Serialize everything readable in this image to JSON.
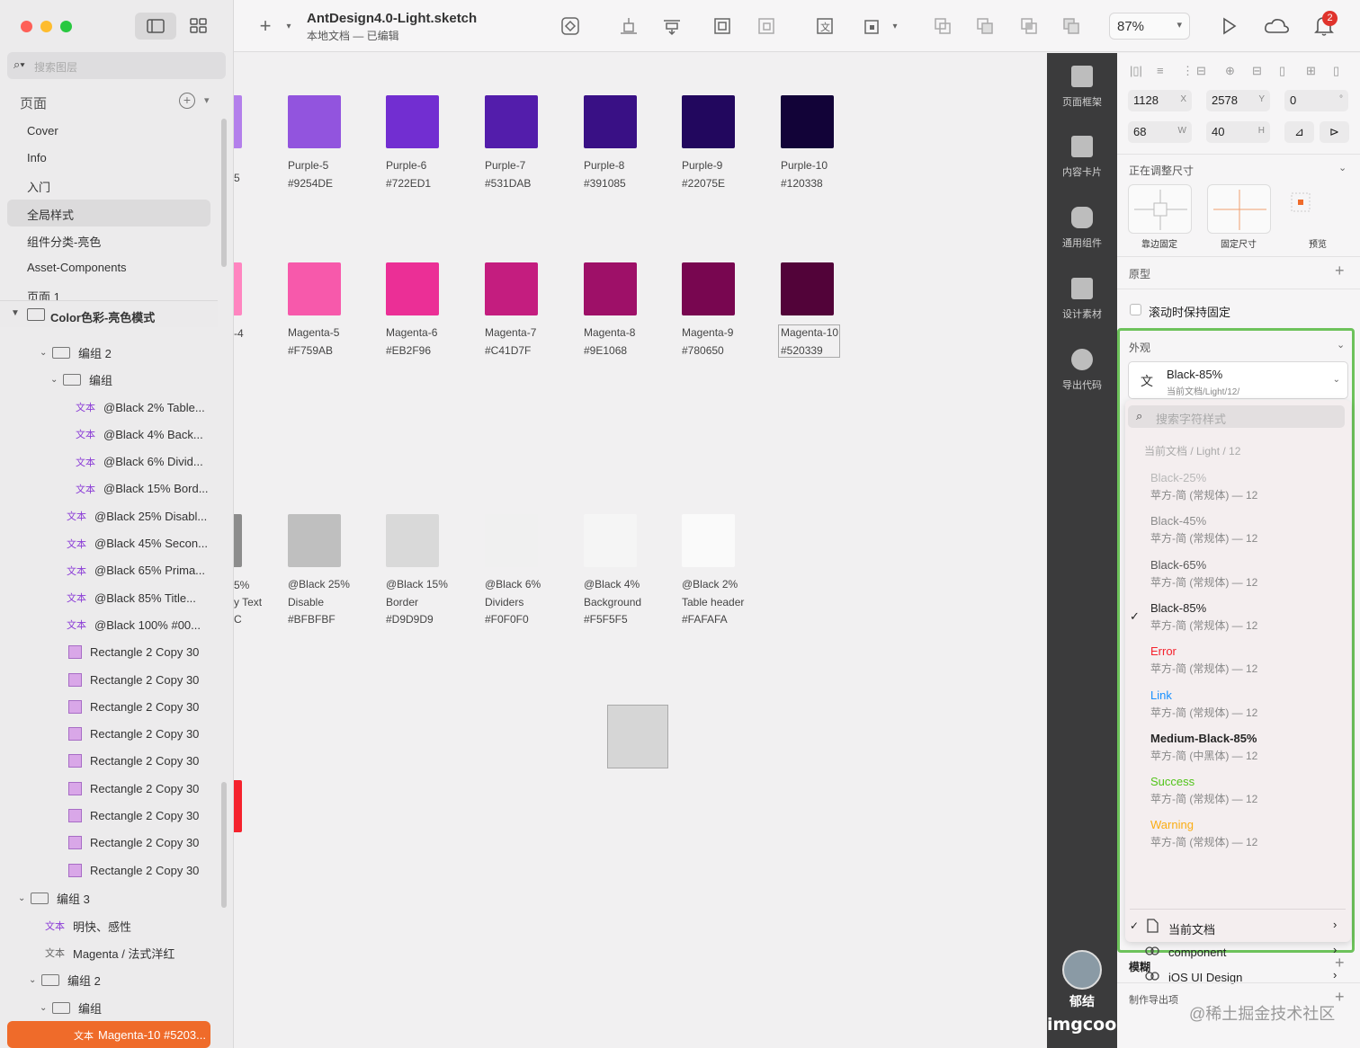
{
  "toolbar": {
    "title": "AntDesign4.0-Light.sketch",
    "subtitle": "本地文档 — 已编辑",
    "zoom": "87%",
    "notification_count": "2"
  },
  "sidebar": {
    "search_placeholder": "搜索图层",
    "pages_header": "页面",
    "pages": [
      "Cover",
      "Info",
      "入门",
      "全局样式",
      "组件分类-亮色",
      "Asset-Components",
      "页面 1"
    ],
    "selected_page_index": 3,
    "layers": {
      "top_artboard": "Color色彩-亮色模式",
      "group2_a": "编组 2",
      "group_a": "编组",
      "text_items": [
        "@Black 2% Table...",
        "@Black 4% Back...",
        "@Black 6% Divid...",
        "@Black 15% Bord..."
      ],
      "text_items2": [
        "@Black 25% Disabl...",
        "@Black 45% Secon...",
        "@Black 65% Prima...",
        "@Black 85% Title...",
        "@Black 100% #00..."
      ],
      "rect_label": "Rectangle 2 Copy 30",
      "rect_count": 9,
      "group3": "编组 3",
      "text_bright": "明快、感性",
      "text_magenta": "Magenta / 法式洋红",
      "group2_b": "编组 2",
      "group_b": "编组",
      "selected_layer": "Magenta-10 #5203...",
      "text_badge": "文本"
    }
  },
  "canvas": {
    "purple": [
      {
        "name": "Purple-5",
        "hex": "#9254DE",
        "color": "#9254DE"
      },
      {
        "name": "Purple-6",
        "hex": "#722ED1",
        "color": "#722ED1"
      },
      {
        "name": "Purple-7",
        "hex": "#531DAB",
        "color": "#531DAB"
      },
      {
        "name": "Purple-8",
        "hex": "#391085",
        "color": "#391085"
      },
      {
        "name": "Purple-9",
        "hex": "#22075E",
        "color": "#22075E"
      },
      {
        "name": "Purple-10",
        "hex": "#120338",
        "color": "#120338"
      }
    ],
    "magenta": [
      {
        "name": "Magenta-5",
        "hex": "#F759AB",
        "color": "#F759AB"
      },
      {
        "name": "Magenta-6",
        "hex": "#EB2F96",
        "color": "#EB2F96"
      },
      {
        "name": "Magenta-7",
        "hex": "#C41D7F",
        "color": "#C41D7F"
      },
      {
        "name": "Magenta-8",
        "hex": "#9E1068",
        "color": "#9E1068"
      },
      {
        "name": "Magenta-9",
        "hex": "#780650",
        "color": "#780650"
      },
      {
        "name": "Magenta-10",
        "hex": "#520339",
        "color": "#520339"
      }
    ],
    "black": [
      {
        "name": "@Black 25%",
        "sub": "Disable",
        "hex": "#BFBFBF",
        "color": "#BFBFBF"
      },
      {
        "name": "@Black 15%",
        "sub": "Border",
        "hex": "#D9D9D9",
        "color": "#D9D9D9"
      },
      {
        "name": "@Black 6%",
        "sub": "Dividers",
        "hex": "#F0F0F0",
        "color": "#F0F0F0"
      },
      {
        "name": "@Black 4%",
        "sub": "Background",
        "hex": "#F5F5F5",
        "color": "#F5F5F5"
      },
      {
        "name": "@Black 2%",
        "sub": "Table header",
        "hex": "#FAFAFA",
        "color": "#FAFAFA"
      }
    ],
    "edge_texts": [
      "-4",
      "5%",
      "y Text",
      "C",
      "5"
    ]
  },
  "dark_panel": {
    "items": [
      "页面框架",
      "内容卡片",
      "通用组件",
      "设计素材",
      "导出代码"
    ],
    "user": "郁结",
    "brand": "imgcook"
  },
  "inspector": {
    "x": "1128",
    "y": "2578",
    "rotation": "0",
    "w": "68",
    "h": "40",
    "x_unit": "X",
    "y_unit": "Y",
    "w_unit": "W",
    "h_unit": "H",
    "deg_unit": "°",
    "resizing_label": "正在调整尺寸",
    "pin_labels": [
      "靠边固定",
      "固定尺寸",
      "预览"
    ],
    "prototype_label": "原型",
    "fix_on_scroll": "滚动时保持固定",
    "appearance_label": "外观",
    "style_name": "Black-85%",
    "style_path": "当前文档/Light/12/",
    "dropdown": {
      "search_placeholder": "搜索字符样式",
      "group_label": "当前文档 / Light / 12",
      "styles": [
        {
          "name": "Black-25%",
          "font": "苹方-简 (常规体) — 12",
          "color": "#b8b8b8"
        },
        {
          "name": "Black-45%",
          "font": "苹方-简 (常规体) — 12",
          "color": "#8c8c8c"
        },
        {
          "name": "Black-65%",
          "font": "苹方-简 (常规体) — 12",
          "color": "#595959"
        },
        {
          "name": "Black-85%",
          "font": "苹方-简 (常规体) — 12",
          "color": "#262626",
          "checked": "✓"
        },
        {
          "name": "Error",
          "font": "苹方-简 (常规体) — 12",
          "color": "#f5222d"
        },
        {
          "name": "Link",
          "font": "苹方-简 (常规体) — 12",
          "color": "#1890ff"
        },
        {
          "name": "Medium-Black-85%",
          "font": "苹方-简 (中黑体) — 12",
          "color": "#262626"
        },
        {
          "name": "Success",
          "font": "苹方-简 (常规体) — 12",
          "color": "#52c41a"
        },
        {
          "name": "Warning",
          "font": "苹方-简 (常规体) — 12",
          "color": "#faad14"
        }
      ],
      "libraries": [
        {
          "name": "当前文档",
          "checked": "✓",
          "icon": "document-icon"
        },
        {
          "name": "component",
          "checked": "",
          "icon": "library-link-icon"
        },
        {
          "name": "iOS UI Design",
          "checked": "",
          "icon": "library-link-icon"
        }
      ]
    },
    "blur_label": "模糊",
    "export_label": "制作导出项",
    "watermark": "@稀土掘金技术社区"
  }
}
